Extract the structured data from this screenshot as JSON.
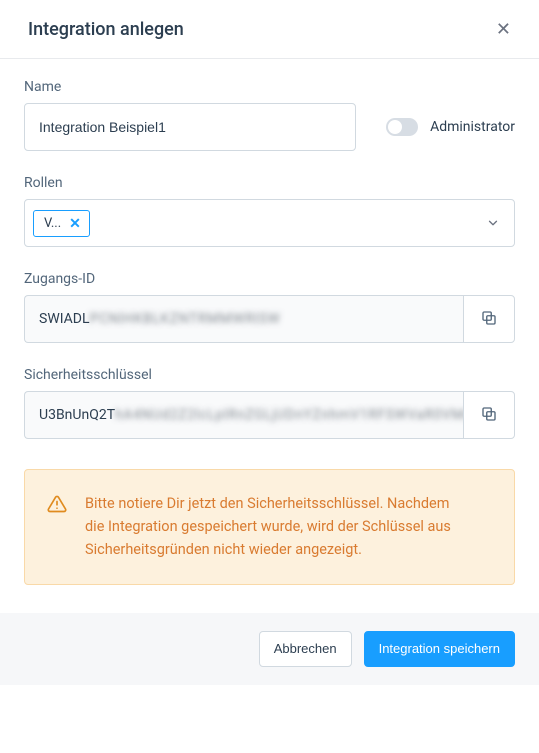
{
  "header": {
    "title": "Integration anlegen"
  },
  "name": {
    "label": "Name",
    "value": "Integration Beispiel1"
  },
  "admin": {
    "label": "Administrator",
    "enabled": false
  },
  "roles": {
    "label": "Rollen",
    "selected": [
      {
        "label": "V..."
      }
    ]
  },
  "access_id": {
    "label": "Zugangs-ID",
    "prefix": "SWIADL",
    "masked": "PCNIHKBLKZNTRMMWRISW"
  },
  "secret_key": {
    "label": "Sicherheitsschlüssel",
    "prefix": "U3BnUnQ2T",
    "masked": "hA4NUd2Z2lcLpIRnZGLjUDnYZnhmV1RFSWVaR0VMeEU"
  },
  "alert": {
    "text": "Bitte notiere Dir jetzt den Sicherheitsschlüssel. Nachdem die Integration gespeichert wurde, wird der Schlüssel aus Sicherheitsgründen nicht wieder angezeigt."
  },
  "footer": {
    "cancel": "Abbrechen",
    "save": "Integration speichern"
  },
  "colors": {
    "primary": "#189eff",
    "warning_bg": "#fdf1dd",
    "warning_border": "#f9d9a8",
    "warning_text": "#d97b30"
  }
}
